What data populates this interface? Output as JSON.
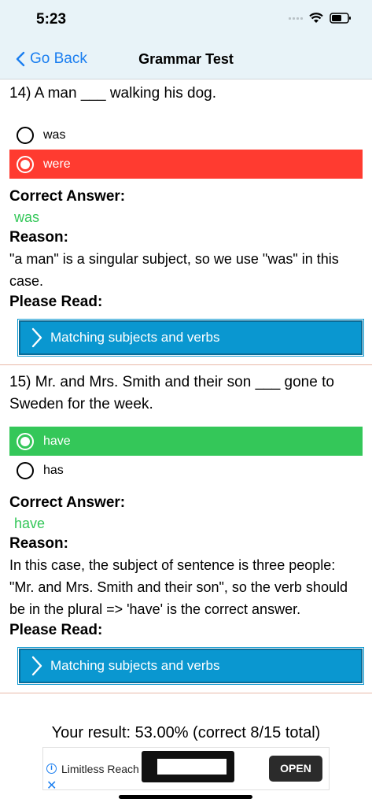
{
  "status": {
    "time": "5:23"
  },
  "nav": {
    "back_label": "Go Back",
    "title": "Grammar Test"
  },
  "q14": {
    "question": "14) A man ___ walking his dog.",
    "options": [
      "was",
      "were"
    ],
    "correct_label": "Correct Answer:",
    "correct_answer": "was",
    "reason_label": "Reason:",
    "reason": "\"a man\" is a singular subject, so we use \"was\" in this case.",
    "read_label": "Please Read:",
    "read_link": "Matching subjects and verbs"
  },
  "q15": {
    "question": "15) Mr. and Mrs. Smith and their son ___ gone to Sweden for the week.",
    "options": [
      "have",
      "has"
    ],
    "correct_label": "Correct Answer:",
    "correct_answer": "have",
    "reason_label": "Reason:",
    "reason": "In this case, the subject of sentence is three people: \"Mr. and Mrs. Smith and their son\", so the verb should be in the plural => 'have' is the correct answer.",
    "read_label": "Please Read:",
    "read_link": "Matching subjects and verbs"
  },
  "result": "Your result: 53.00% (correct 8/15 total)",
  "ad": {
    "text": "Limitless Reach",
    "button": "OPEN",
    "close": "✕",
    "info": "i"
  },
  "colors": {
    "wrong": "#ff3b30",
    "correct": "#34c759",
    "link": "#0a97d0",
    "accent": "#1a7ef0"
  }
}
